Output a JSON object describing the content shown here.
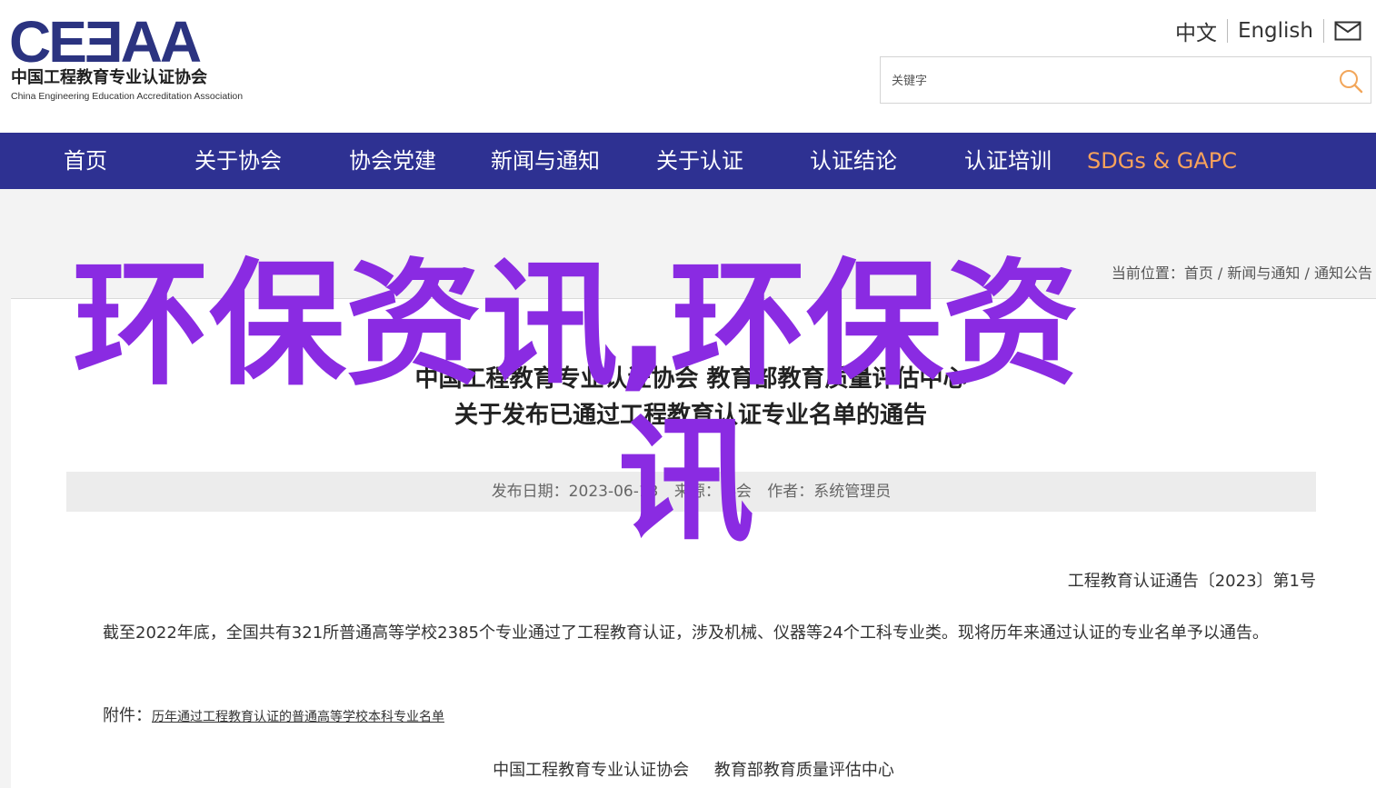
{
  "header": {
    "logo_mark": "CEƎAA",
    "logo_cn": "中国工程教育专业认证协会",
    "logo_en": "China Engineering Education Accreditation Association",
    "lang_cn": "中文",
    "lang_en": "English",
    "mail_icon": "mail-icon"
  },
  "search": {
    "placeholder": "关键字",
    "icon": "search-icon"
  },
  "nav": {
    "items": [
      {
        "label": "首页"
      },
      {
        "label": "关于协会"
      },
      {
        "label": "协会党建"
      },
      {
        "label": "新闻与通知"
      },
      {
        "label": "关于认证"
      },
      {
        "label": "认证结论"
      },
      {
        "label": "认证培训"
      },
      {
        "label": "SDGs & GAPC"
      }
    ],
    "accent_color": "#f7a25b",
    "bg_color": "#2e3192"
  },
  "breadcrumb": {
    "prefix": "当前位置：",
    "items": [
      "首页",
      "新闻与通知",
      "通知公告"
    ],
    "separator": " / "
  },
  "article": {
    "title_line1": "中国工程教育专业认证协会 教育部教育质量评估中心",
    "title_line2": "关于发布已通过工程教育认证专业名单的通告",
    "meta_date": "发布日期：2023-06-13",
    "meta_source": "来源：协会",
    "meta_author": "作者：系统管理员",
    "doc_number": "工程教育认证通告〔2023〕第1号",
    "body": "截至2022年底，全国共有321所普通高等学校2385个专业通过了工程教育认证，涉及机械、仪器等24个工科专业类。现将历年来通过认证的专业名单予以通告。",
    "attachment_label": "附件：",
    "attachment_link": "历年通过工程教育认证的普通高等学校本科专业名单",
    "signature_1": "中国工程教育专业认证协会",
    "signature_2": "教育部教育质量评估中心"
  },
  "overlay": {
    "line1": "环保资讯,环保资",
    "line2": "讯",
    "color": "#8a2be2"
  }
}
